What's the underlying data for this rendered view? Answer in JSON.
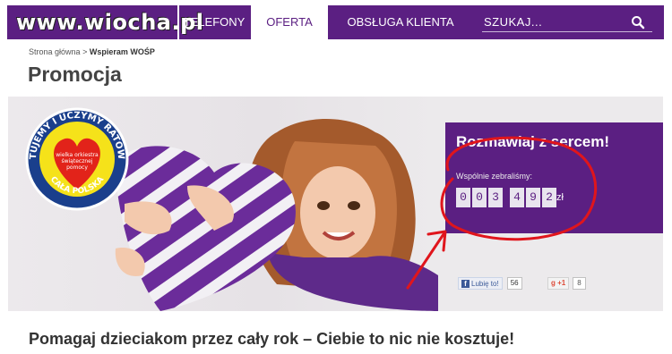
{
  "logo": {
    "text": "www.wiocha.pl"
  },
  "nav": {
    "tabs": [
      {
        "label": "TELEFONY",
        "active": false
      },
      {
        "label": "OFERTA",
        "active": true
      },
      {
        "label": "OBSŁUGA KLIENTA",
        "active": false
      }
    ],
    "search_label": "SZUKAJ..."
  },
  "breadcrumb": {
    "home": "Strona główna",
    "separator": ">",
    "current": "Wspieram WOŚP"
  },
  "page_title": "Promocja",
  "badge": {
    "top_text": "RATUJEMY I UCZYMY RATOWAĆ",
    "heart_lines": [
      "wielka orkiestra",
      "świątecznej",
      "pomocy"
    ],
    "bottom_text": "CAŁA POLSKA"
  },
  "promo": {
    "title": "Rozmawiaj z sercem!",
    "subtitle": "Wspólnie zebraliśmy:",
    "digits": [
      "0",
      "0",
      "3",
      "4",
      "9",
      "2"
    ],
    "currency": "zł"
  },
  "social": {
    "like_label": "Lubię to!",
    "like_count": "56",
    "gplus_label": "+1",
    "gplus_count": "8"
  },
  "footer_heading": "Pomagaj dzieciakom przez cały rok – Ciebie to nic nie kosztuje!",
  "colors": {
    "brand_purple": "#5b1f82",
    "annotation_red": "#e0151c",
    "facebook_blue": "#3b5998"
  }
}
